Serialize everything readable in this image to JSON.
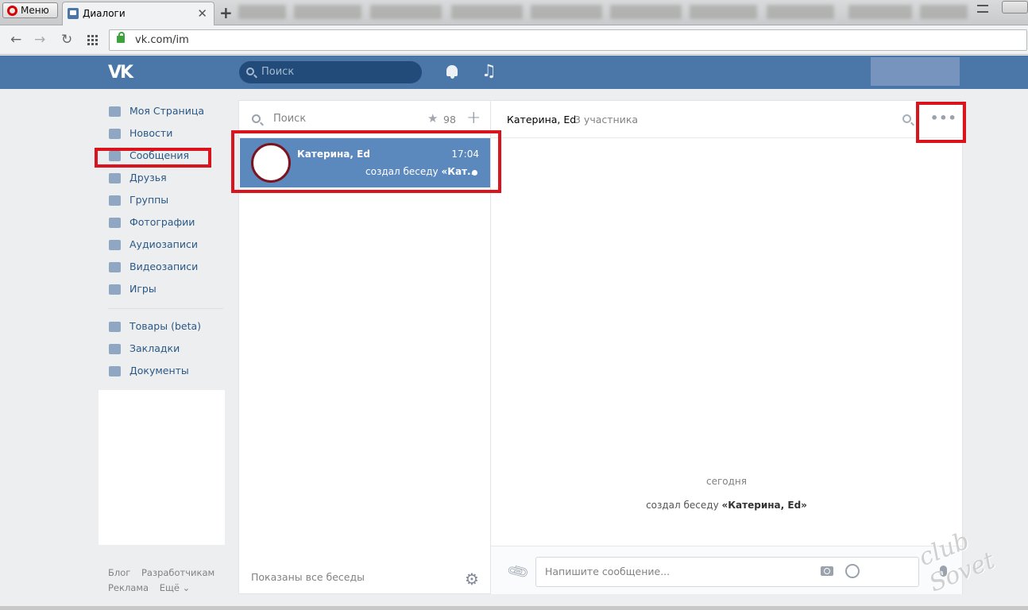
{
  "browser": {
    "menu_label": "Меню",
    "active_tab_title": "Диалоги",
    "tab_close": "✕",
    "new_tab": "+",
    "url": "vk.com/im"
  },
  "header": {
    "logo": "VK",
    "search_placeholder": "Поиск"
  },
  "left_menu": {
    "items": [
      {
        "label": "Моя Страница",
        "icon": "home-icon"
      },
      {
        "label": "Новости",
        "icon": "news-icon"
      },
      {
        "label": "Сообщения",
        "icon": "messages-icon"
      },
      {
        "label": "Друзья",
        "icon": "friends-icon"
      },
      {
        "label": "Группы",
        "icon": "groups-icon"
      },
      {
        "label": "Фотографии",
        "icon": "camera-icon"
      },
      {
        "label": "Аудиозаписи",
        "icon": "music-note-icon"
      },
      {
        "label": "Видеозаписи",
        "icon": "film-icon"
      },
      {
        "label": "Игры",
        "icon": "gamepad-icon"
      }
    ],
    "extra_items": [
      {
        "label": "Товары (beta)",
        "icon": "bag-icon"
      },
      {
        "label": "Закладки",
        "icon": "star-icon"
      },
      {
        "label": "Документы",
        "icon": "document-icon"
      }
    ],
    "footer": {
      "blog": "Блог",
      "developers": "Разработчикам",
      "ads": "Реклама",
      "more": "Ещё ⌄"
    }
  },
  "dialogs": {
    "search_placeholder": "Поиск",
    "important_count": "98",
    "add": "+",
    "items": [
      {
        "name": "Катерина, Ed",
        "time": "17:04",
        "preview_prefix": "создал беседу ",
        "preview_bold": "«Кат..."
      }
    ],
    "footer": "Показаны все беседы"
  },
  "chat": {
    "title": "Катерина, Ed",
    "members": "3 участника",
    "more": "•••",
    "date": "сегодня",
    "system_prefix": "создал беседу ",
    "system_bold": "«Катерина, Ed»",
    "input_placeholder": "Напишите сообщение..."
  },
  "watermark": "club Sovet",
  "colors": {
    "vk_blue": "#4a76a8",
    "selected_dialog": "#5b88bd",
    "highlight_red": "#d9141c"
  }
}
